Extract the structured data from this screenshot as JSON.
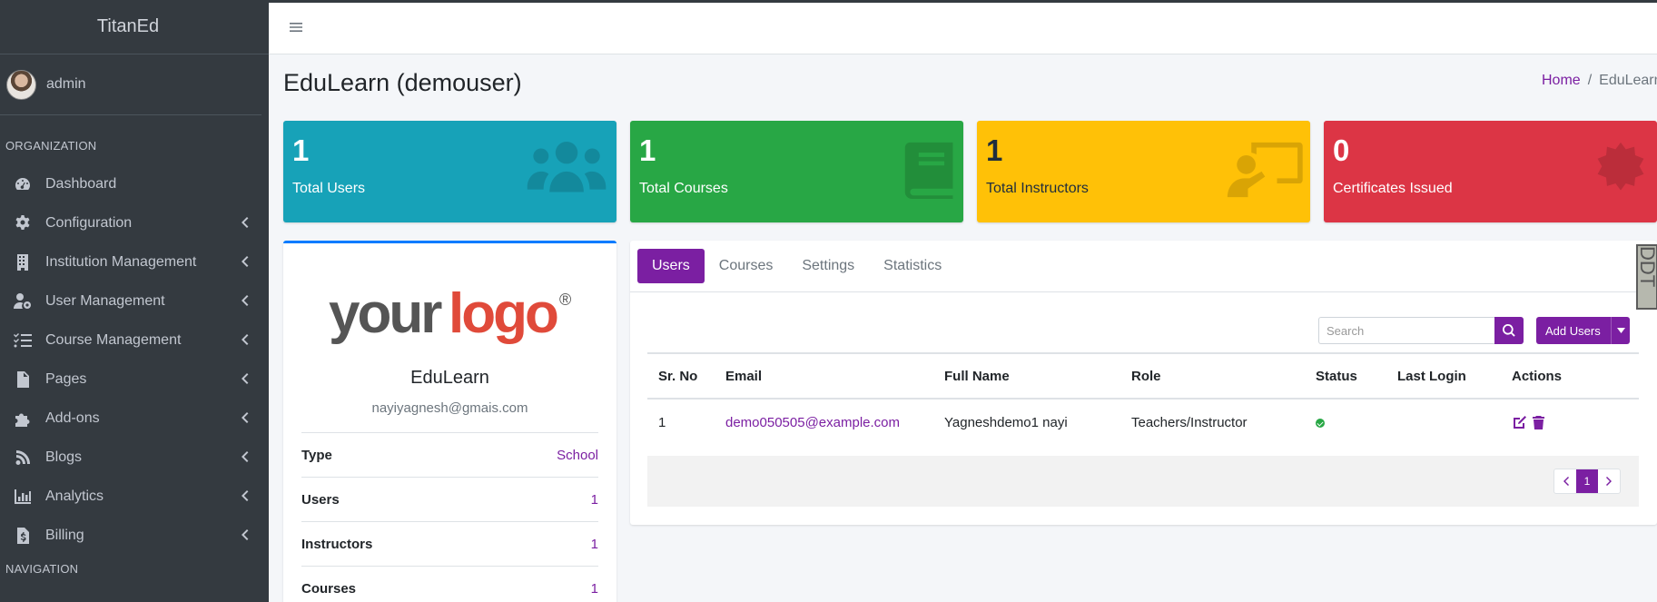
{
  "app": {
    "brand": "TitanEd"
  },
  "user": {
    "name": "admin"
  },
  "sidebar": {
    "section_org": "ORGANIZATION",
    "section_nav": "NAVIGATION",
    "items": [
      {
        "label": "Dashboard",
        "icon": "dashboard-icon",
        "has_children": false
      },
      {
        "label": "Configuration",
        "icon": "gear-icon",
        "has_children": true
      },
      {
        "label": "Institution Management",
        "icon": "building-icon",
        "has_children": true
      },
      {
        "label": "User Management",
        "icon": "user-cog-icon",
        "has_children": true
      },
      {
        "label": "Course Management",
        "icon": "tasks-icon",
        "has_children": true
      },
      {
        "label": "Pages",
        "icon": "file-icon",
        "has_children": true
      },
      {
        "label": "Add-ons",
        "icon": "puzzle-icon",
        "has_children": true
      },
      {
        "label": "Blogs",
        "icon": "blog-icon",
        "has_children": true
      },
      {
        "label": "Analytics",
        "icon": "chart-icon",
        "has_children": true
      },
      {
        "label": "Billing",
        "icon": "invoice-icon",
        "has_children": true
      }
    ]
  },
  "page": {
    "title": "EduLearn (demouser)"
  },
  "breadcrumb": {
    "home": "Home",
    "separator": "/",
    "current": "EduLearn"
  },
  "stats": [
    {
      "value": "1",
      "label": "Total Users",
      "color": "#17a2b8",
      "icon": "users-icon"
    },
    {
      "value": "1",
      "label": "Total Courses",
      "color": "#28a745",
      "icon": "book-icon"
    },
    {
      "value": "1",
      "label": "Total Instructors",
      "color": "#ffc107",
      "icon": "chalkboard-teacher-icon"
    },
    {
      "value": "0",
      "label": "Certificates Issued",
      "color": "#dc3545",
      "icon": "certificate-icon"
    }
  ],
  "profile": {
    "logo_text_1": "your",
    "logo_text_2": "logo",
    "logo_mark": "®",
    "name": "EduLearn",
    "email": "nayiyagnesh@gmais.com",
    "rows": [
      {
        "label": "Type",
        "value": "School"
      },
      {
        "label": "Users",
        "value": "1"
      },
      {
        "label": "Instructors",
        "value": "1"
      },
      {
        "label": "Courses",
        "value": "1"
      }
    ]
  },
  "tabs": [
    "Users",
    "Courses",
    "Settings",
    "Statistics"
  ],
  "side_tag": "DDT",
  "search": {
    "placeholder": "Search"
  },
  "add_users": {
    "label": "Add Users"
  },
  "table": {
    "headers": [
      "Sr. No",
      "Email",
      "Full Name",
      "Role",
      "Status",
      "Last Login",
      "Actions"
    ],
    "rows": [
      {
        "sr": "1",
        "email": "demo050505@example.com",
        "full_name": "Yagneshdemo1 nayi",
        "role": "Teachers/Instructor",
        "last_login": ""
      }
    ]
  },
  "pagination": {
    "current": "1"
  },
  "colors": {
    "accent": "#7b1fa2",
    "sidebar_bg": "#343a40"
  }
}
